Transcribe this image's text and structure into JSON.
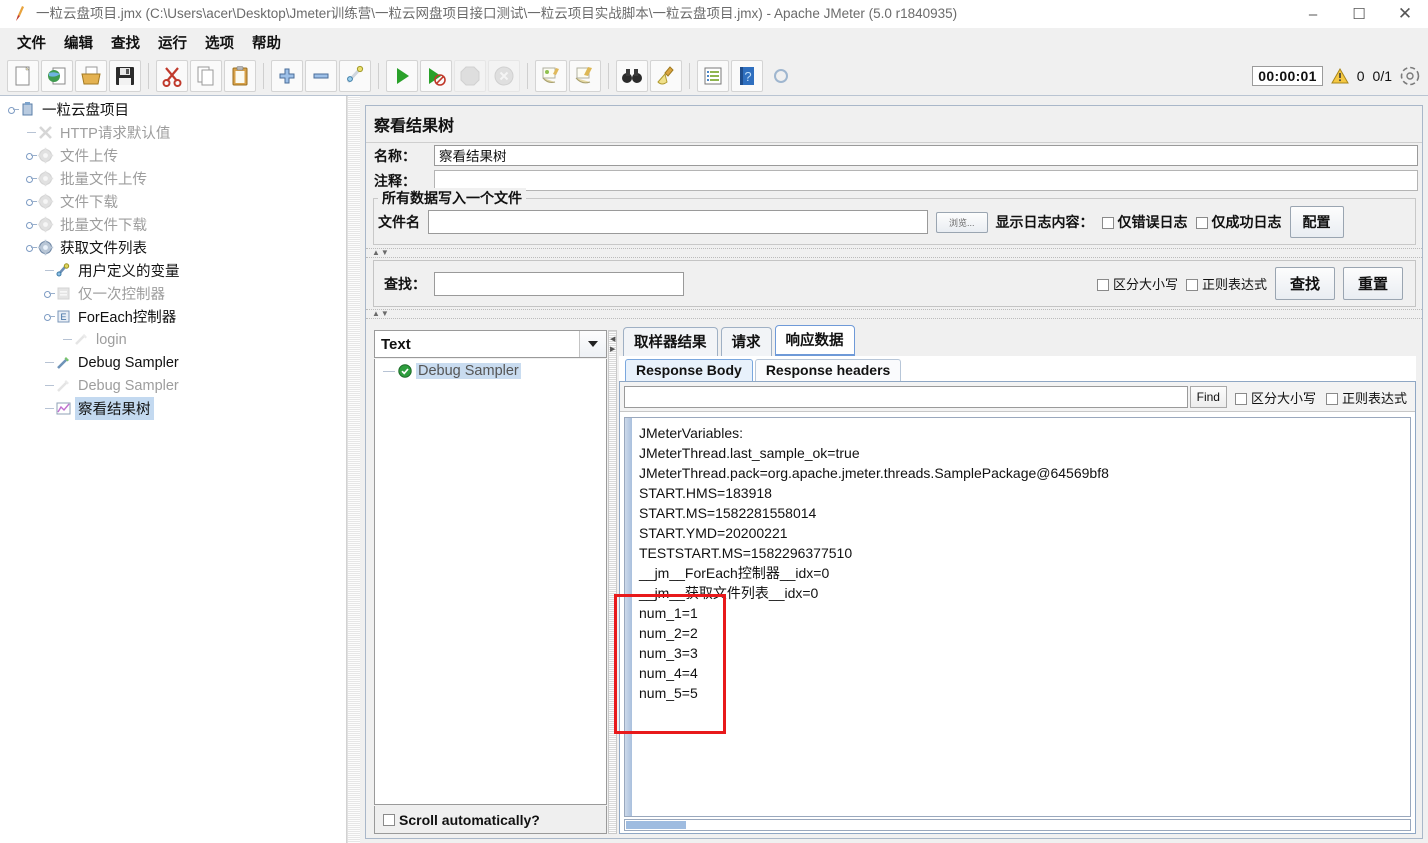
{
  "window": {
    "title": "一粒云盘项目.jmx (C:\\Users\\acer\\Desktop\\Jmeter训练营\\一粒云网盘项目接口测试\\一粒云项目实战脚本\\一粒云盘项目.jmx) - Apache JMeter (5.0 r1840935)",
    "minimize": "–",
    "maximize": "☐",
    "close": "✕",
    "app_icon": "jmeter-feather-icon"
  },
  "menubar": {
    "items": [
      {
        "label": "文件",
        "name": "menu-file"
      },
      {
        "label": "编辑",
        "name": "menu-edit"
      },
      {
        "label": "查找",
        "name": "menu-search"
      },
      {
        "label": "运行",
        "name": "menu-run"
      },
      {
        "label": "选项",
        "name": "menu-options"
      },
      {
        "label": "帮助",
        "name": "menu-help"
      }
    ]
  },
  "toolbar": {
    "buttons": [
      {
        "name": "new-button",
        "icon": "new-page-icon"
      },
      {
        "name": "templates-button",
        "icon": "globe-page-icon"
      },
      {
        "name": "open-button",
        "icon": "open-folder-icon"
      },
      {
        "name": "save-button",
        "icon": "floppy-save-icon"
      },
      {
        "name": "cut-button",
        "icon": "scissors-icon"
      },
      {
        "name": "copy-button",
        "icon": "copy-pages-icon"
      },
      {
        "name": "paste-button",
        "icon": "clipboard-icon"
      },
      {
        "name": "expand-all-button",
        "icon": "plus-icon"
      },
      {
        "name": "collapse-all-button",
        "icon": "minus-icon"
      },
      {
        "name": "toggle-button",
        "icon": "wand-toggle-icon"
      },
      {
        "name": "start-button",
        "icon": "green-play-icon"
      },
      {
        "name": "start-no-pauses-button",
        "icon": "green-play-nopause-icon"
      },
      {
        "name": "stop-button",
        "icon": "stop-octagon-icon"
      },
      {
        "name": "shutdown-button",
        "icon": "shutdown-circle-icon"
      },
      {
        "name": "clear-button",
        "icon": "broom-clear-icon"
      },
      {
        "name": "clear-all-button",
        "icon": "broom-clear-all-icon"
      },
      {
        "name": "search-button",
        "icon": "binoculars-icon"
      },
      {
        "name": "search-reset-button",
        "icon": "broom-reset-icon"
      },
      {
        "name": "function-helper-button",
        "icon": "list-function-icon"
      },
      {
        "name": "help-button",
        "icon": "blue-help-book-icon"
      },
      {
        "name": "extra-button",
        "icon": "gear-extra-icon"
      }
    ],
    "status": {
      "elapsed": "00:00:01",
      "warning_icon": "warning-triangle-icon",
      "warning_count": "0",
      "threads": "0/1",
      "spinner_icon": "activity-spinner-icon"
    }
  },
  "tree": {
    "nodes": [
      {
        "label": "一粒云盘项目",
        "indent": 0,
        "icon": "test-plan-icon",
        "state": "normal",
        "handle": "knob"
      },
      {
        "label": "HTTP请求默认值",
        "indent": 1,
        "icon": "config-gear-x-icon",
        "state": "disabled",
        "handle": "dash"
      },
      {
        "label": "文件上传",
        "indent": 1,
        "icon": "thread-group-icon",
        "state": "disabled",
        "handle": "knob"
      },
      {
        "label": "批量文件上传",
        "indent": 1,
        "icon": "thread-group-icon",
        "state": "disabled",
        "handle": "knob"
      },
      {
        "label": "文件下载",
        "indent": 1,
        "icon": "thread-group-icon",
        "state": "disabled",
        "handle": "knob"
      },
      {
        "label": "批量文件下载",
        "indent": 1,
        "icon": "thread-group-icon",
        "state": "disabled",
        "handle": "knob"
      },
      {
        "label": "获取文件列表",
        "indent": 1,
        "icon": "thread-group-active-icon",
        "state": "normal",
        "handle": "knob"
      },
      {
        "label": "用户定义的变量",
        "indent": 2,
        "icon": "user-variables-icon",
        "state": "normal",
        "handle": "dash"
      },
      {
        "label": "仅一次控制器",
        "indent": 2,
        "icon": "once-only-controller-icon",
        "state": "disabled",
        "handle": "knob"
      },
      {
        "label": "ForEach控制器",
        "indent": 2,
        "icon": "foreach-controller-icon",
        "state": "normal",
        "handle": "knob"
      },
      {
        "label": "login",
        "indent": 3,
        "icon": "http-sampler-icon",
        "state": "disabled",
        "handle": "dash"
      },
      {
        "label": "Debug Sampler",
        "indent": 2,
        "icon": "debug-sampler-icon",
        "state": "normal",
        "handle": "dash"
      },
      {
        "label": "Debug Sampler",
        "indent": 2,
        "icon": "debug-sampler-icon",
        "state": "disabled",
        "handle": "dash"
      },
      {
        "label": "察看结果树",
        "indent": 2,
        "icon": "view-results-tree-icon",
        "state": "selected",
        "handle": "dash"
      }
    ]
  },
  "panel": {
    "title": "察看结果树",
    "name_label": "名称：",
    "name_value": "察看结果树",
    "comment_label": "注释：",
    "comment_value": "",
    "file_group_legend": "所有数据写入一个文件",
    "filename_label": "文件名",
    "filename_value": "",
    "browse_button": "浏览...",
    "log_display_label": "显示日志内容：",
    "errors_only": "仅错误日志",
    "success_only": "仅成功日志",
    "configure_button": "配置",
    "search_label": "查找：",
    "search_value": "",
    "case_sensitive": "区分大小写",
    "regex": "正则表达式",
    "search_button": "查找",
    "reset_button": "重置"
  },
  "results": {
    "renderer_selected": "Text",
    "renderer_arrow_icon": "chevron-down-icon",
    "sampler_items": [
      {
        "label": "Debug Sampler",
        "status_icon": "success-shield-icon",
        "selected": true
      }
    ],
    "scroll_auto_label": "Scroll automatically?",
    "tabs": [
      {
        "label": "取样器结果",
        "active": false,
        "name": "tab-sampler-result"
      },
      {
        "label": "请求",
        "active": false,
        "name": "tab-request"
      },
      {
        "label": "响应数据",
        "active": true,
        "name": "tab-response-data"
      }
    ],
    "subtabs": [
      {
        "label": "Response Body",
        "active": true,
        "name": "tab-response-body"
      },
      {
        "label": "Response headers",
        "active": false,
        "name": "tab-response-headers"
      }
    ],
    "find": {
      "value": "",
      "button": "Find",
      "case_sensitive": "区分大小写",
      "regex": "正则表达式"
    },
    "response_body": "JMeterVariables:\nJMeterThread.last_sample_ok=true\nJMeterThread.pack=org.apache.jmeter.threads.SamplePackage@64569bf8\nSTART.HMS=183918\nSTART.MS=1582281558014\nSTART.YMD=20200221\nTESTSTART.MS=1582296377510\n__jm__ForEach控制器__idx=0\n__jm__获取文件列表__idx=0\nnum_1=1\nnum_2=2\nnum_3=3\nnum_4=4\nnum_5=5"
  },
  "annotation": {
    "name": "red-highlight-rectangle",
    "color": "#e8191b"
  }
}
